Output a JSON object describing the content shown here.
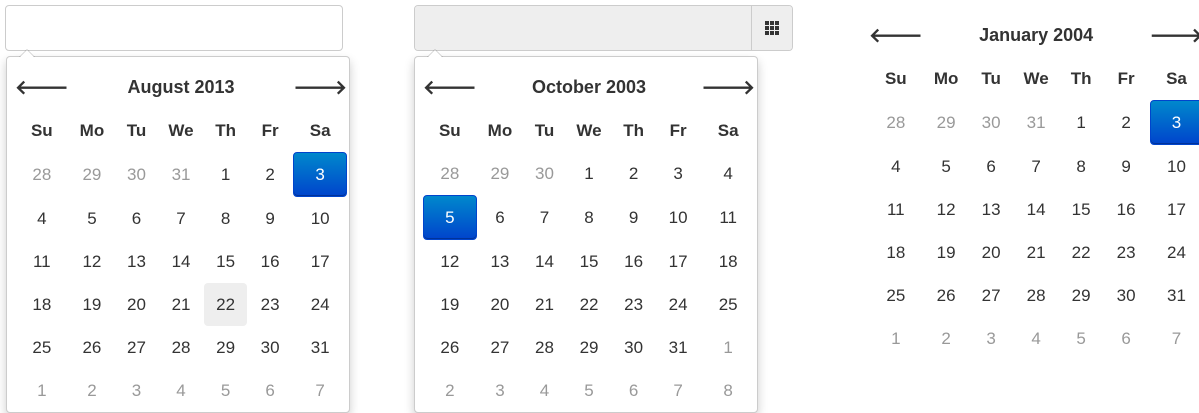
{
  "colors": {
    "accent_top": "#0088cc",
    "accent_bottom": "#0044cc",
    "muted_day": "#999999",
    "hover_day": "#eeeeee",
    "text": "#333333"
  },
  "weekdays": [
    "Su",
    "Mo",
    "Tu",
    "We",
    "Th",
    "Fr",
    "Sa"
  ],
  "nav": {
    "prev_icon": "arrow-left-icon",
    "next_icon": "arrow-right-icon",
    "prev": "🡐",
    "next": "🡒"
  },
  "inputs": {
    "first": {
      "value": "",
      "placeholder": ""
    },
    "second": {
      "value": "",
      "placeholder": "",
      "addon_icon": "calendar-grid-icon"
    }
  },
  "calendars": [
    {
      "title": "August 2013",
      "active": 3,
      "hover": 22,
      "weeks": [
        [
          28,
          29,
          30,
          31,
          1,
          2,
          3
        ],
        [
          4,
          5,
          6,
          7,
          8,
          9,
          10
        ],
        [
          11,
          12,
          13,
          14,
          15,
          16,
          17
        ],
        [
          18,
          19,
          20,
          21,
          22,
          23,
          24
        ],
        [
          25,
          26,
          27,
          28,
          29,
          30,
          31
        ],
        [
          1,
          2,
          3,
          4,
          5,
          6,
          7
        ]
      ]
    },
    {
      "title": "October 2003",
      "active": 5,
      "hover": null,
      "weeks": [
        [
          28,
          29,
          30,
          1,
          2,
          3,
          4
        ],
        [
          5,
          6,
          7,
          8,
          9,
          10,
          11
        ],
        [
          12,
          13,
          14,
          15,
          16,
          17,
          18
        ],
        [
          19,
          20,
          21,
          22,
          23,
          24,
          25
        ],
        [
          26,
          27,
          28,
          29,
          30,
          31,
          1
        ],
        [
          2,
          3,
          4,
          5,
          6,
          7,
          8
        ]
      ]
    },
    {
      "title": "January 2004",
      "active": 3,
      "hover": null,
      "weeks": [
        [
          28,
          29,
          30,
          31,
          1,
          2,
          3
        ],
        [
          4,
          5,
          6,
          7,
          8,
          9,
          10
        ],
        [
          11,
          12,
          13,
          14,
          15,
          16,
          17
        ],
        [
          18,
          19,
          20,
          21,
          22,
          23,
          24
        ],
        [
          25,
          26,
          27,
          28,
          29,
          30,
          31
        ],
        [
          1,
          2,
          3,
          4,
          5,
          6,
          7
        ]
      ]
    }
  ]
}
